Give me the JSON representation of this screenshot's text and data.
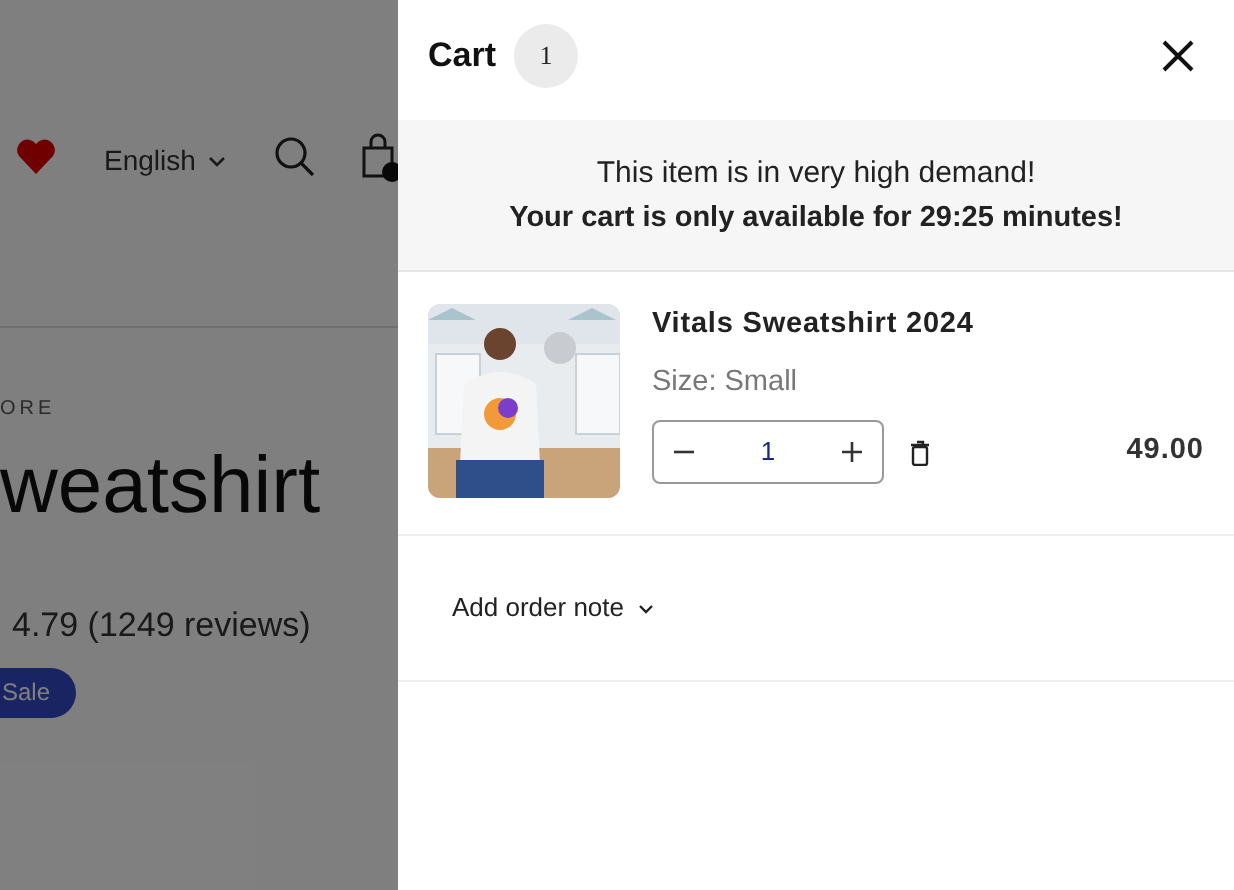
{
  "page": {
    "language": "English",
    "vendor": "ORE",
    "title": "weatshirt",
    "rating": "4.79 (1249 reviews)",
    "badge": "Sale"
  },
  "cart": {
    "title": "Cart",
    "count": "1",
    "notice": {
      "line1": "This item is in very high demand!",
      "line2": "Your cart is only available for 29:25 minutes!"
    },
    "items": [
      {
        "name": "Vitals Sweatshirt 2024",
        "option": "Size: Small",
        "quantity": "1",
        "price": "49.00"
      }
    ],
    "order_note": "Add order note"
  }
}
